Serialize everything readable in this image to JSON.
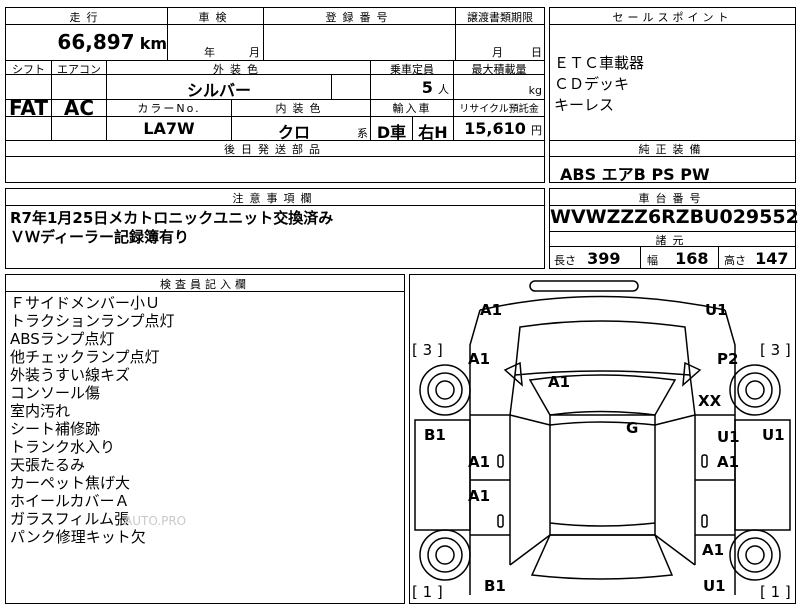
{
  "sheet": {
    "mileage": {
      "header": "走行",
      "value": "66,897",
      "unit": "km"
    },
    "inspection": {
      "header": "車検",
      "year_label": "年",
      "month_label": "月"
    },
    "registration": {
      "header": "登録番号"
    },
    "transfer": {
      "header": "譲渡書類期限",
      "month_label": "月",
      "day_label": "日"
    },
    "shift": {
      "header": "シフト",
      "value": "FAT"
    },
    "aircon": {
      "header": "エアコン",
      "value": "AC"
    },
    "exterior": {
      "header": "外装色",
      "value": "シルバー"
    },
    "capacity": {
      "header": "乗車定員",
      "value": "5",
      "unit": "人"
    },
    "max_load": {
      "header": "最大積載量",
      "unit": "kg"
    },
    "color_no": {
      "header": "カラーNo.",
      "value": "LA7W"
    },
    "interior": {
      "header": "内装色",
      "value": "クロ",
      "suffix": "系"
    },
    "import": {
      "header": "輸入車",
      "value1": "D車",
      "value2": "右H"
    },
    "recycle": {
      "header": "リサイクル預託金",
      "value": "15,610",
      "unit": "円"
    },
    "later_parts": {
      "header": "後日発送部品"
    },
    "notice": {
      "header": "注意事項欄",
      "lines": [
        "R7年1月25日メカトロニックユニット交換済み",
        "ＶＷディーラー記録簿有り"
      ]
    },
    "inspector": {
      "header": "検査員記入欄",
      "lines": [
        "Ｆサイドメンバー小Ｕ",
        "トラクションランプ点灯",
        "ABSランプ点灯",
        "他チェックランプ点灯",
        "外装うすい線キズ",
        "コンソール傷",
        "室内汚れ",
        "シート補修跡",
        "トランク水入り",
        "天張たるみ",
        "カーペット焦げ大",
        "ホイールカバーＡ",
        "ガラスフィルム張",
        "パンク修理キット欠"
      ]
    }
  },
  "sales_points": {
    "header": "セールスポイント",
    "lines": [
      "ＥＴＣ車載器",
      "ＣＤデッキ",
      "キーレス"
    ]
  },
  "equipment": {
    "header": "純正装備",
    "value": "ABS エアB PS PW"
  },
  "chassis": {
    "header": "車台番号",
    "value": "WVWZZZ6RZBU029552"
  },
  "specs": {
    "header": "諸元",
    "length_label": "長さ",
    "length": "399",
    "width_label": "幅",
    "width": "168",
    "height_label": "高さ",
    "height": "147"
  },
  "diagram": {
    "marks": {
      "a1_fl_top": "A1",
      "u1_fr_top": "U1",
      "bracket_left_top": "[ 3 ]",
      "bracket_right_top": "[ 3 ]",
      "a1_left_fender": "A1",
      "p2_right_fender": "P2",
      "a1_hood": "A1",
      "xx": "XX",
      "b1_left": "B1",
      "g_roof": "G",
      "u1_right_door": "U1",
      "u1_right_edge": "U1",
      "a1_left_door1": "A1",
      "a1_right_door1": "A1",
      "a1_left_door2": "A1",
      "a1_right_rear": "A1",
      "bracket_left_bottom": "[ 1 ]",
      "bracket_right_bottom": "[ 1 ]",
      "b1_bottom": "B1",
      "u1_bottom": "U1"
    },
    "watermark": "AUTO.PRO"
  },
  "colors": {
    "line": "#000000",
    "watermark": "#c9c9c9"
  }
}
